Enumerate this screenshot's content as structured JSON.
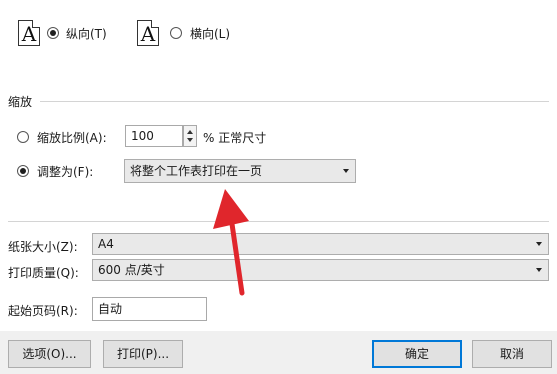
{
  "orientation": {
    "portrait_label": "纵向(T)",
    "landscape_label": "横向(L)",
    "icon_letter": "A",
    "selected": "portrait"
  },
  "scaling": {
    "section_title": "缩放",
    "scale_label": "缩放比例(A):",
    "scale_value": "100",
    "scale_suffix": "% 正常尺寸",
    "fit_label": "调整为(F):",
    "fit_value": "将整个工作表打印在一页",
    "selected": "fit"
  },
  "paper": {
    "size_label": "纸张大小(Z):",
    "size_value": "A4",
    "quality_label": "打印质量(Q):",
    "quality_value": "600 点/英寸",
    "start_page_label": "起始页码(R):",
    "start_page_value": "自动"
  },
  "buttons": {
    "options_label": "选项(O)...",
    "print_label": "打印(P)...",
    "ok_label": "确定",
    "cancel_label": "取消"
  },
  "colors": {
    "annotation_arrow": "#e0262c",
    "default_button_border": "#0078d7"
  }
}
